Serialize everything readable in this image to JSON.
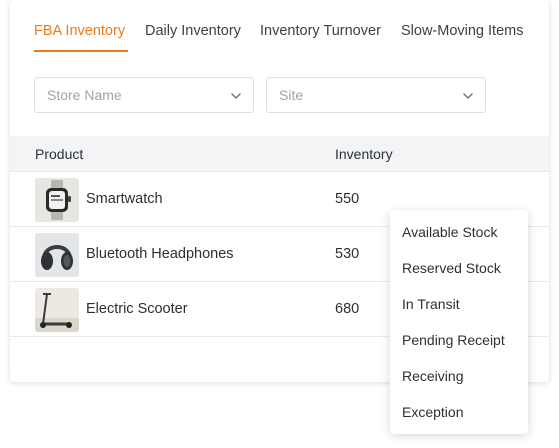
{
  "tabs": [
    {
      "label": "FBA Inventory",
      "active": true
    },
    {
      "label": "Daily Inventory",
      "active": false
    },
    {
      "label": "Inventory Turnover",
      "active": false
    },
    {
      "label": "Slow-Moving Items",
      "active": false
    }
  ],
  "filters": {
    "store_placeholder": "Store Name",
    "site_placeholder": "Site"
  },
  "table": {
    "columns": [
      "Product",
      "Inventory"
    ],
    "rows": [
      {
        "product": "Smartwatch",
        "inventory": "550",
        "icon": "smartwatch-image"
      },
      {
        "product": "Bluetooth Headphones",
        "inventory": "530",
        "icon": "headphones-image"
      },
      {
        "product": "Electric Scooter",
        "inventory": "680",
        "icon": "scooter-image"
      }
    ]
  },
  "dropdown": {
    "items": [
      "Available Stock",
      "Reserved Stock",
      "In Transit",
      "Pending Receipt",
      "Receiving",
      "Exception"
    ]
  },
  "colors": {
    "accent": "#f07a1a",
    "header_bg": "#f3f4f6",
    "border": "#dcdfe6"
  }
}
